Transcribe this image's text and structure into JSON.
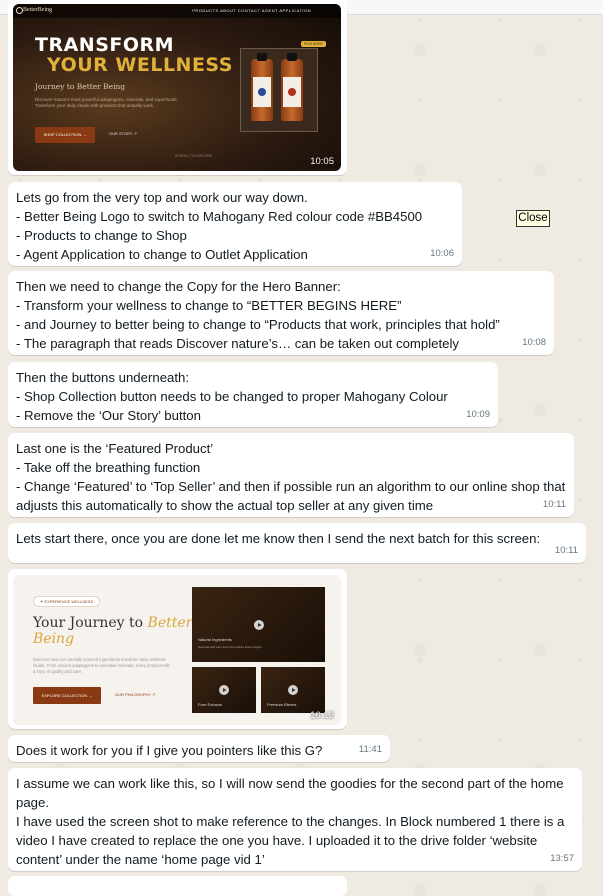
{
  "tooltip": {
    "close_label": "Close"
  },
  "images": [
    {
      "time": "10:05",
      "mockup": {
        "logo": "BetterBeing",
        "nav_links": "PRODUCTS   ABOUT   CONTACT   AGENT APPLICATION",
        "headline_line1": "TRANSFORM",
        "headline_line2": "YOUR WELLNESS",
        "subheadline": "Journey to Better Being",
        "paragraph": "Discover nature's most powerful adaptogens, minerals, and superfoods. Transform your daily rituals with products that actually work.",
        "button_primary": "SHOP COLLECTION  →",
        "button_secondary": "OUR STORY  ↗",
        "badge": "FEATURED",
        "scroll_hint": "SCROLL TO EXPLORE"
      }
    },
    {
      "time": "10:12",
      "mockup": {
        "pill": "✦ EXPERIENCE WELLNESS",
        "heading_plain": "Your Journey to ",
        "heading_accent": "Better",
        "heading_line2": "Being",
        "paragraph": "Discover how our carefully sourced ingredients transform daily wellness rituals. From ancient adaptogens to essential minerals, every product tells a story of quality and care.",
        "button_primary": "EXPLORE COLLECTION  →",
        "button_secondary": "OUR PHILOSOPHY  ↗",
        "video_main_title": "Natural Ingredients",
        "video_main_sub": "Sourced with care from the world's finest origins",
        "video_small_1": "Pure Extracts",
        "video_small_2": "Premium Blends"
      }
    }
  ],
  "messages": [
    {
      "text": "Lets go from the very top and work our way down.\n- Better Being Logo to switch to Mahogany Red colour code #BB4500\n- Products to change to Shop\n- Agent Application to change to Outlet Application",
      "time": "10:06"
    },
    {
      "text": "Then we need to change the Copy for the Hero Banner:\n- Transform your wellness to change to “BETTER BEGINS HERE”\n- and Journey to better being to change to “Products that work, principles that hold”\n- The paragraph that reads Discover nature’s… can be taken out completely",
      "time": "10:08"
    },
    {
      "text": "Then the buttons underneath:\n- Shop Collection button needs to be changed to proper Mahogany Colour\n- Remove the ‘Our Story’ button",
      "time": "10:09"
    },
    {
      "text": "Last one is the ‘Featured Product’\n- Take off the breathing function\n- Change ‘Featured’ to ‘Top Seller’ and then if possible run an algorithm to our online shop that adjusts this automatically to show the actual top seller at any given time",
      "time": "10:11"
    },
    {
      "text": "Lets start there, once you are done let me know then I send the next batch for this screen:",
      "time": "10:11"
    },
    {
      "text": "Does it work for you if I give you pointers like this G?",
      "time": "11:41"
    },
    {
      "text": "I assume we can work like this, so I will now send the goodies for the second part of the home page.\nI have used the screen shot to make reference to the changes. In Block numbered 1 there is a video I have created to replace the one you have. I uploaded it to the drive folder ‘website content’ under the name ‘home page vid 1’",
      "time": "13:57"
    }
  ]
}
